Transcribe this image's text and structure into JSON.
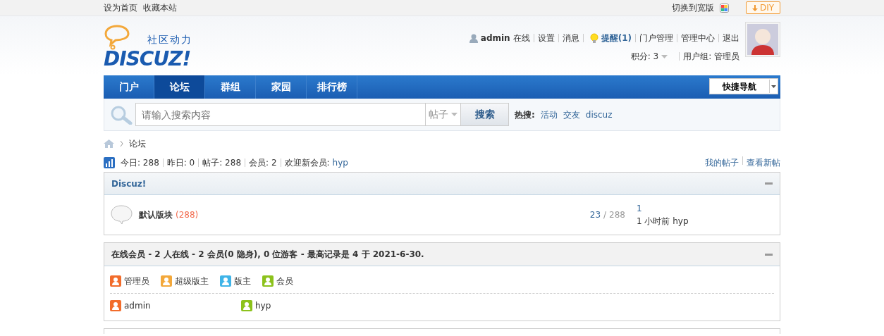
{
  "topbar": {
    "links": [
      "设为首页",
      "收藏本站"
    ],
    "wide_switch": "切换到宽版",
    "diy": "DIY"
  },
  "logo": {
    "tagline": "社区动力",
    "name": "DISCUZ!"
  },
  "user": {
    "name": "admin",
    "status": "在线",
    "links": [
      "设置",
      "消息"
    ],
    "reminder": "提醒(1)",
    "admin_links": [
      "门户管理",
      "管理中心",
      "退出"
    ],
    "credits": "积分: 3",
    "group": "用户组: 管理员"
  },
  "nav": {
    "items": [
      {
        "label": "门户",
        "selected": false
      },
      {
        "label": "论坛",
        "selected": true
      },
      {
        "label": "群组",
        "selected": false
      },
      {
        "label": "家园",
        "selected": false
      },
      {
        "label": "排行榜",
        "selected": false
      }
    ],
    "quick_nav": "快捷导航"
  },
  "search": {
    "placeholder": "请输入搜索内容",
    "scope": "帖子",
    "button": "搜索",
    "hot_label": "热搜:",
    "hot": [
      "活动",
      "交友",
      "discuz"
    ]
  },
  "breadcrumb": [
    "论坛"
  ],
  "stats": [
    {
      "label": "今日:",
      "value": "288"
    },
    {
      "label": "昨日:",
      "value": "0"
    },
    {
      "label": "帖子:",
      "value": "288"
    },
    {
      "label": "会员:",
      "value": "2"
    }
  ],
  "welcome": {
    "label": "欢迎新会员:",
    "name": "hyp"
  },
  "stat_links": [
    "我的帖子",
    "查看新帖"
  ],
  "category": {
    "title": "Discuz!",
    "forums": [
      {
        "name": "默认版块",
        "today": "(288)",
        "threads": "23",
        "divider": "/",
        "posts": "288",
        "last_post": "1",
        "last_time": "1 小时前 hyp"
      }
    ]
  },
  "online": {
    "title": "在线会员 - 2 人在线 - 2 会员(0 隐身), 0 位游客 - 最高记录是 4 于 2021-6-30.",
    "legend": [
      {
        "label": "管理员",
        "color": "#f26c2b"
      },
      {
        "label": "超级版主",
        "color": "#f3a83b"
      },
      {
        "label": "版主",
        "color": "#3fb4e8"
      },
      {
        "label": "会员",
        "color": "#8cc21c"
      }
    ],
    "members": [
      {
        "name": "admin",
        "color": "#f26c2b"
      },
      {
        "name": "hyp",
        "color": "#8cc21c"
      }
    ]
  }
}
